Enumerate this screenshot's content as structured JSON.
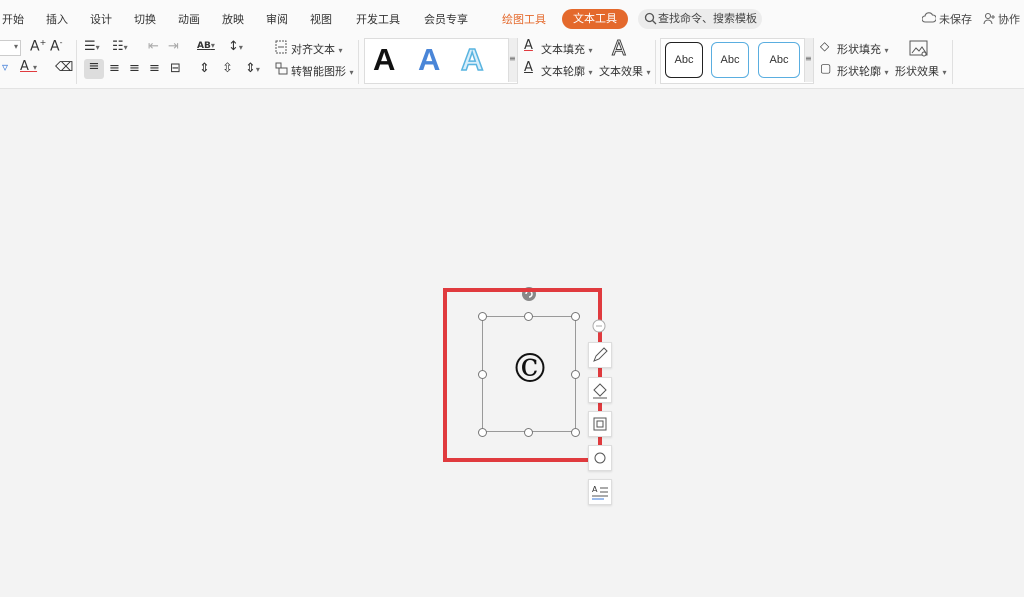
{
  "tabs": [
    {
      "label": "开始"
    },
    {
      "label": "插入"
    },
    {
      "label": "设计"
    },
    {
      "label": "切换"
    },
    {
      "label": "动画"
    },
    {
      "label": "放映"
    },
    {
      "label": "审阅"
    },
    {
      "label": "视图"
    },
    {
      "label": "开发工具"
    },
    {
      "label": "会员专享"
    },
    {
      "label": "绘图工具"
    },
    {
      "label": "文本工具"
    }
  ],
  "search": {
    "placeholder": "查找命令、搜索模板"
  },
  "header": {
    "unsaved": "未保存",
    "collab": "协作"
  },
  "ribbon": {
    "align_text": "对齐文本",
    "smart_shape": "转智能图形",
    "text_fill": "文本填充",
    "text_outline": "文本轮廓",
    "text_effect": "文本效果",
    "shape_fill": "形状填充",
    "shape_outline": "形状轮廓",
    "shape_effect": "形状效果",
    "text_styles": [
      "A",
      "A",
      "A"
    ],
    "shape_styles": [
      "Abc",
      "Abc",
      "Abc"
    ]
  },
  "canvas": {
    "symbol": "©"
  },
  "colors": {
    "accent": "#e4692c",
    "highlight": "#e03a3e",
    "blue": "#3b7ad8"
  }
}
